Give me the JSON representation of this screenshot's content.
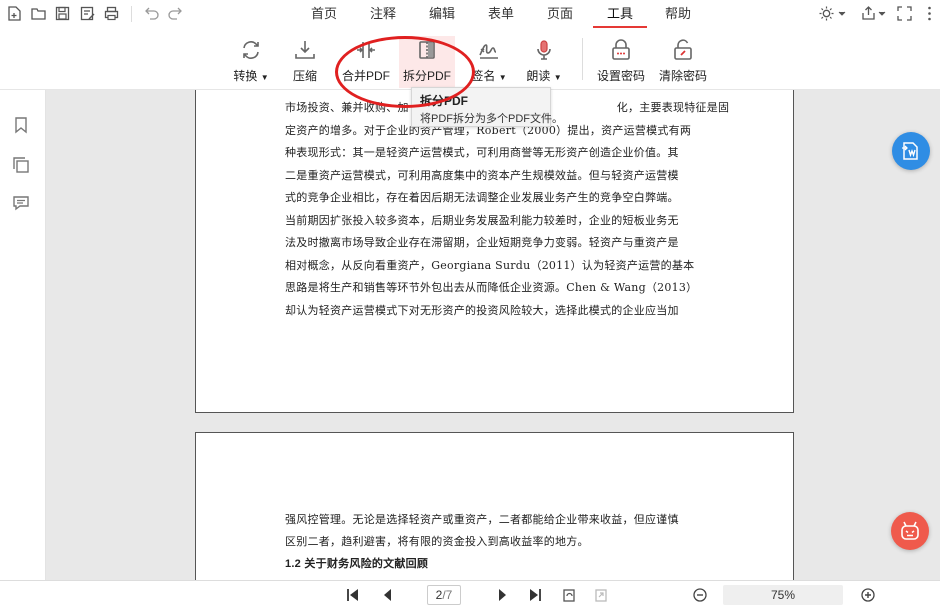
{
  "menu": {
    "tabs": [
      "首页",
      "注释",
      "编辑",
      "表单",
      "页面",
      "工具",
      "帮助"
    ],
    "active_tab": "工具",
    "accent_color": "#e53935"
  },
  "quick_access": [
    "new-file-icon",
    "open-folder-icon",
    "save-icon",
    "save-as-icon",
    "print-icon",
    "undo-icon",
    "redo-icon"
  ],
  "window_controls": [
    "brightness-icon",
    "share-icon",
    "fullscreen-icon",
    "more-icon"
  ],
  "ribbon": {
    "tools": [
      {
        "label": "转换",
        "icon": "convert-icon",
        "dropdown": true
      },
      {
        "label": "压缩",
        "icon": "compress-icon",
        "dropdown": false
      },
      {
        "label": "合并PDF",
        "icon": "merge-pdf-icon",
        "dropdown": false
      },
      {
        "label": "拆分PDF",
        "icon": "split-pdf-icon",
        "dropdown": false,
        "highlighted": true
      },
      {
        "label": "签名",
        "icon": "signature-icon",
        "dropdown": true
      },
      {
        "label": "朗读",
        "icon": "read-aloud-icon",
        "dropdown": true
      },
      {
        "label": "设置密码",
        "icon": "set-password-icon",
        "dropdown": false
      },
      {
        "label": "清除密码",
        "icon": "remove-password-icon",
        "dropdown": false
      }
    ]
  },
  "tooltip": {
    "title": "拆分PDF",
    "description": "将PDF拆分为多个PDF文件。"
  },
  "document": {
    "page1_lines": [
      "市场投资、兼并收购、加",
      "化，主要表现特征是固",
      "定资产的增多。对于企业的资产管理，Robert（2000）提出，资产运营模式有两",
      "种表现形式：其一是轻资产运营模式，可利用商誉等无形资产创造企业价值。其",
      "二是重资产运营模式，可利用高度集中的资本产生规模效益。但与轻资产运营模",
      "式的竞争企业相比，存在着因后期无法调整企业发展业务产生的竞争空白弊端。",
      "当前期因扩张投入较多资本，后期业务发展盈利能力较差时，企业的短板业务无",
      "法及时撤离市场导致企业存在滞留期，企业短期竞争力变弱。轻资产与重资产是",
      "相对概念，从反向看重资产，Georgiana Surdu（2011）认为轻资产运营的基本",
      "思路是将生产和销售等环节外包出去从而降低企业资源。Chen & Wang（2013）",
      "却认为轻资产运营模式下对无形资产的投资风险较大，选择此模式的企业应当加"
    ],
    "page2_lines": [
      "强风控管理。无论是选择轻资产或重资产，二者都能给企业带来收益，但应谨慎",
      "区别二者，趋利避害，将有限的资金投入到高收益率的地方。"
    ],
    "page2_heading": "1.2 关于财务风险的文献回顾"
  },
  "status": {
    "current_page": "2",
    "total_pages": "/7",
    "zoom": "75%"
  }
}
